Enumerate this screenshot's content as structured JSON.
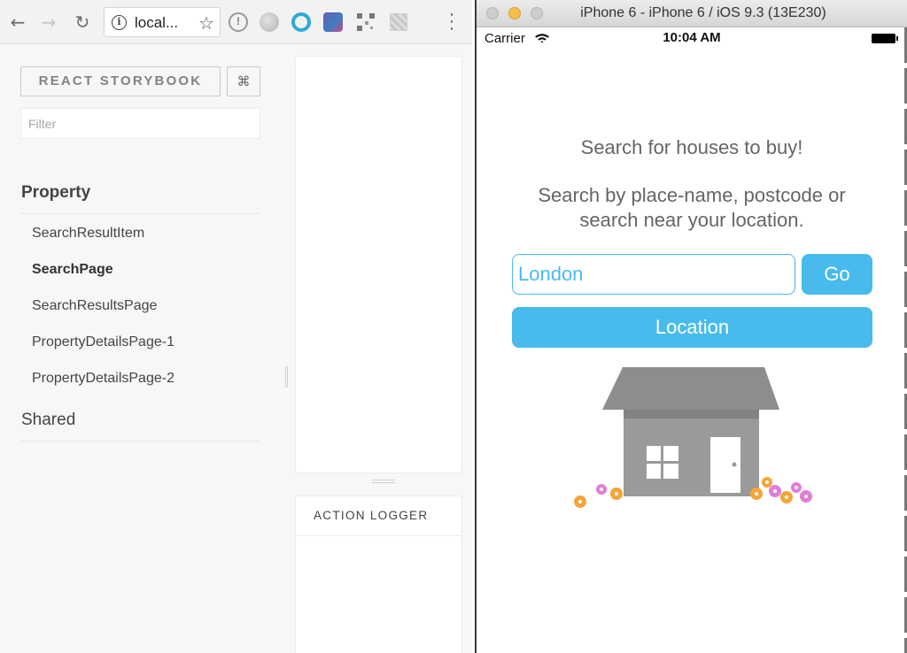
{
  "browser": {
    "url_text": "local...",
    "icons": [
      "back-arrow-icon",
      "forward-arrow-icon",
      "reload-icon",
      "info-icon",
      "bookmark-star-icon",
      "extension-icons",
      "menu-dots-icon"
    ]
  },
  "storybook": {
    "brand_label": "REACT STORYBOOK",
    "shortcut_label": "⌘",
    "filter_placeholder": "Filter",
    "kinds": [
      {
        "name": "Property",
        "stories": [
          "SearchResultItem",
          "SearchPage",
          "SearchResultsPage",
          "PropertyDetailsPage-1",
          "PropertyDetailsPage-2"
        ],
        "selected_story": "SearchPage"
      },
      {
        "name": "Shared",
        "stories": []
      }
    ],
    "action_logger_label": "ACTION LOGGER"
  },
  "simulator": {
    "window_title": "iPhone 6 - iPhone 6 / iOS 9.3 (13E230)",
    "status": {
      "carrier": "Carrier",
      "time": "10:04 AM"
    },
    "app": {
      "heading": "Search for houses to buy!",
      "description_line1": "Search by place-name, postcode or",
      "description_line2": "search near your location.",
      "search_value": "London",
      "go_label": "Go",
      "location_label": "Location"
    },
    "colors": {
      "accent": "#48bbec",
      "text": "#656565"
    }
  }
}
